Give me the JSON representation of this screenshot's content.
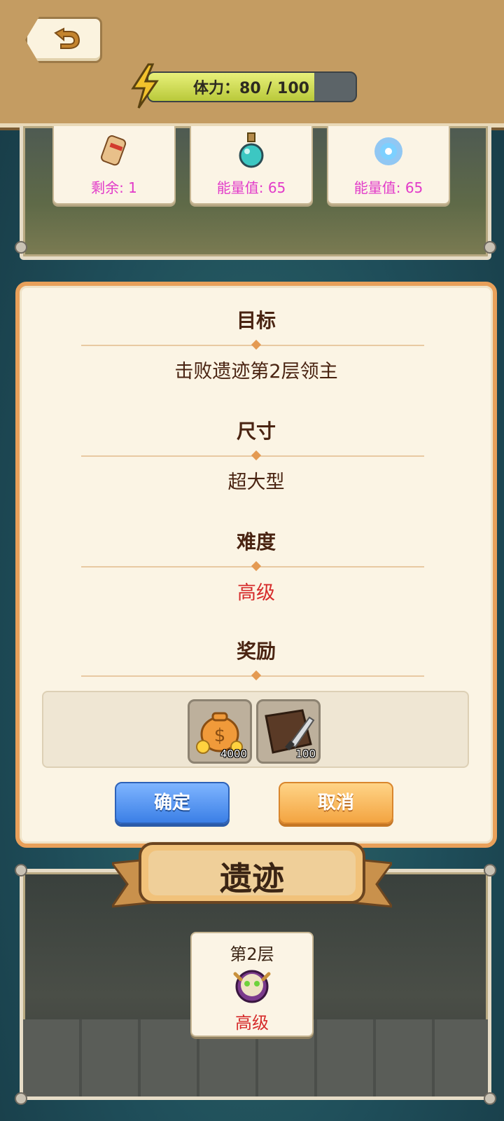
{
  "header": {
    "stamina_label": "体力：80 / 100",
    "stamina_fraction": 0.8
  },
  "top_cards": [
    {
      "label": "剩余: 1",
      "icon": "scroll-icon"
    },
    {
      "label": "能量值: 65",
      "icon": "potion-icon"
    },
    {
      "label": "能量值: 65",
      "icon": "vortex-icon"
    }
  ],
  "dialog": {
    "goal_title": "目标",
    "goal_value": "击败遗迹第2层领主",
    "size_title": "尺寸",
    "size_value": "超大型",
    "difficulty_title": "难度",
    "difficulty_value": "高级",
    "reward_title": "奖励",
    "rewards": [
      {
        "icon": "coin-bag-icon",
        "qty": "4000"
      },
      {
        "icon": "leather-knife-icon",
        "qty": "100"
      }
    ],
    "confirm_label": "确定",
    "cancel_label": "取消"
  },
  "location": {
    "title": "遗迹",
    "floor_label": "第2层",
    "floor_difficulty": "高级"
  },
  "colors": {
    "accent_orange": "#e8a05a",
    "difficulty_red": "#d62b2b",
    "card_label_magenta": "#e23ac9"
  }
}
